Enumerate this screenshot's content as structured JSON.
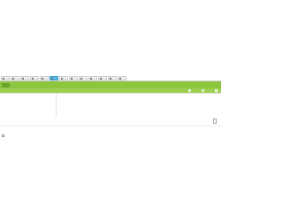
{
  "browser": {
    "tabs": [
      {
        "label": "",
        "active": false
      },
      {
        "label": "",
        "active": false
      },
      {
        "label": "",
        "active": false
      },
      {
        "label": "",
        "active": false
      },
      {
        "label": "",
        "active": false
      },
      {
        "label": "",
        "active": true
      },
      {
        "label": "",
        "active": false
      },
      {
        "label": "",
        "active": false
      },
      {
        "label": "",
        "active": false
      },
      {
        "label": "",
        "active": false
      },
      {
        "label": "",
        "active": false
      },
      {
        "label": "",
        "active": false
      },
      {
        "label": "",
        "active": false
      }
    ]
  },
  "header": {
    "logo_text": "",
    "title": "",
    "icons": [
      "refresh-icon",
      "help-icon",
      "settings-icon"
    ]
  },
  "content": {
    "section_title": "",
    "panel_note": "",
    "section2_title": "",
    "checkbox_label": ""
  },
  "colors": {
    "header_green": "#8cc63f",
    "subheader_green": "#9dd052",
    "active_tab": "#5ab9e6"
  }
}
